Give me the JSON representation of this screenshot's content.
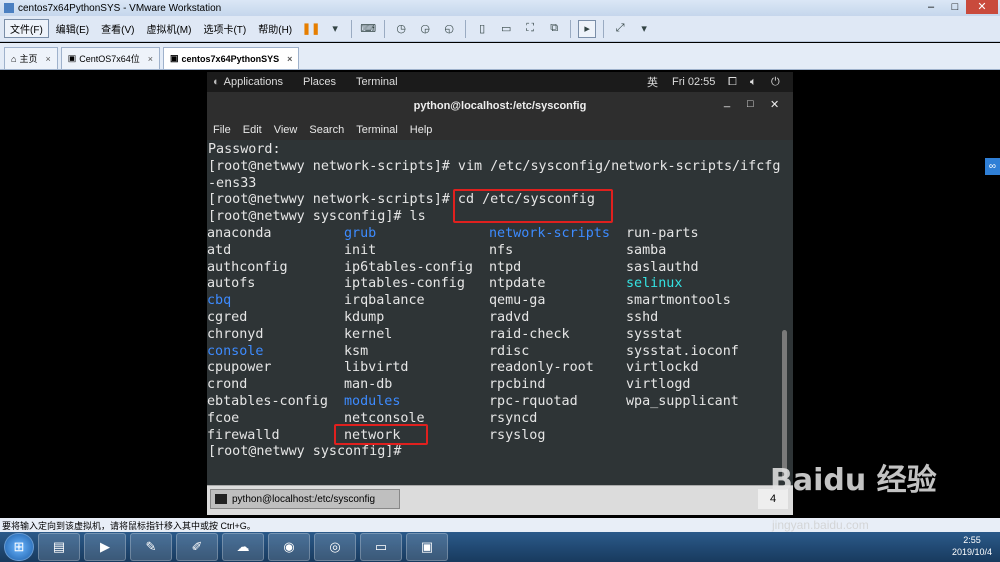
{
  "window": {
    "title": "centos7x64PythonSYS - VMware Workstation"
  },
  "menus": [
    "文件(F)",
    "编辑(E)",
    "查看(V)",
    "虚拟机(M)",
    "选项卡(T)",
    "帮助(H)"
  ],
  "tabs": [
    {
      "label": "主页"
    },
    {
      "label": "CentOS7x64位"
    },
    {
      "label": "centos7x64PythonSYS"
    }
  ],
  "gnome": {
    "applications": "Applications",
    "places": "Places",
    "terminal": "Terminal",
    "ime": "英",
    "time": "Fri 02:55"
  },
  "terminal": {
    "title": "python@localhost:/etc/sysconfig",
    "menu": [
      "File",
      "Edit",
      "View",
      "Search",
      "Terminal",
      "Help"
    ],
    "lines": [
      "Password:",
      "[root@netwwy network-scripts]# vim /etc/sysconfig/network-scripts/ifcfg",
      "-ens33",
      "[root@netwwy network-scripts]# cd /etc/sysconfig",
      "[root@netwwy sysconfig]# ls"
    ],
    "ls_rows": [
      [
        "anaconda",
        "grub",
        "network-scripts",
        "run-parts"
      ],
      [
        "atd",
        "init",
        "nfs",
        "samba"
      ],
      [
        "authconfig",
        "ip6tables-config",
        "ntpd",
        "saslauthd"
      ],
      [
        "autofs",
        "iptables-config",
        "ntpdate",
        "selinux"
      ],
      [
        "cbq",
        "irqbalance",
        "qemu-ga",
        "smartmontools"
      ],
      [
        "cgred",
        "kdump",
        "radvd",
        "sshd"
      ],
      [
        "chronyd",
        "kernel",
        "raid-check",
        "sysstat"
      ],
      [
        "console",
        "ksm",
        "rdisc",
        "sysstat.ioconf"
      ],
      [
        "cpupower",
        "libvirtd",
        "readonly-root",
        "virtlockd"
      ],
      [
        "crond",
        "man-db",
        "rpcbind",
        "virtlogd"
      ],
      [
        "ebtables-config",
        "modules",
        "rpc-rquotad",
        "wpa_supplicant"
      ],
      [
        "fcoe",
        "netconsole",
        "rsyncd",
        ""
      ],
      [
        "firewalld",
        "network",
        "rsyslog",
        ""
      ]
    ],
    "prompt": "[root@netwwy sysconfig]#"
  },
  "guest_taskbar": {
    "item": "python@localhost:/etc/sysconfig",
    "page": "4"
  },
  "statusbar": {
    "text": "要将输入定向到该虚拟机，请将鼠标指针移入其中或按 Ctrl+G。"
  },
  "clock": {
    "time": "2:55",
    "date": "2019/10/4"
  },
  "watermark": {
    "brand": "Baidu 经验",
    "url": "jingyan.baidu.com"
  },
  "colors": {
    "dir": "#3d8bff",
    "cyan": "#34e2e2",
    "highlight": "#e0201e"
  }
}
